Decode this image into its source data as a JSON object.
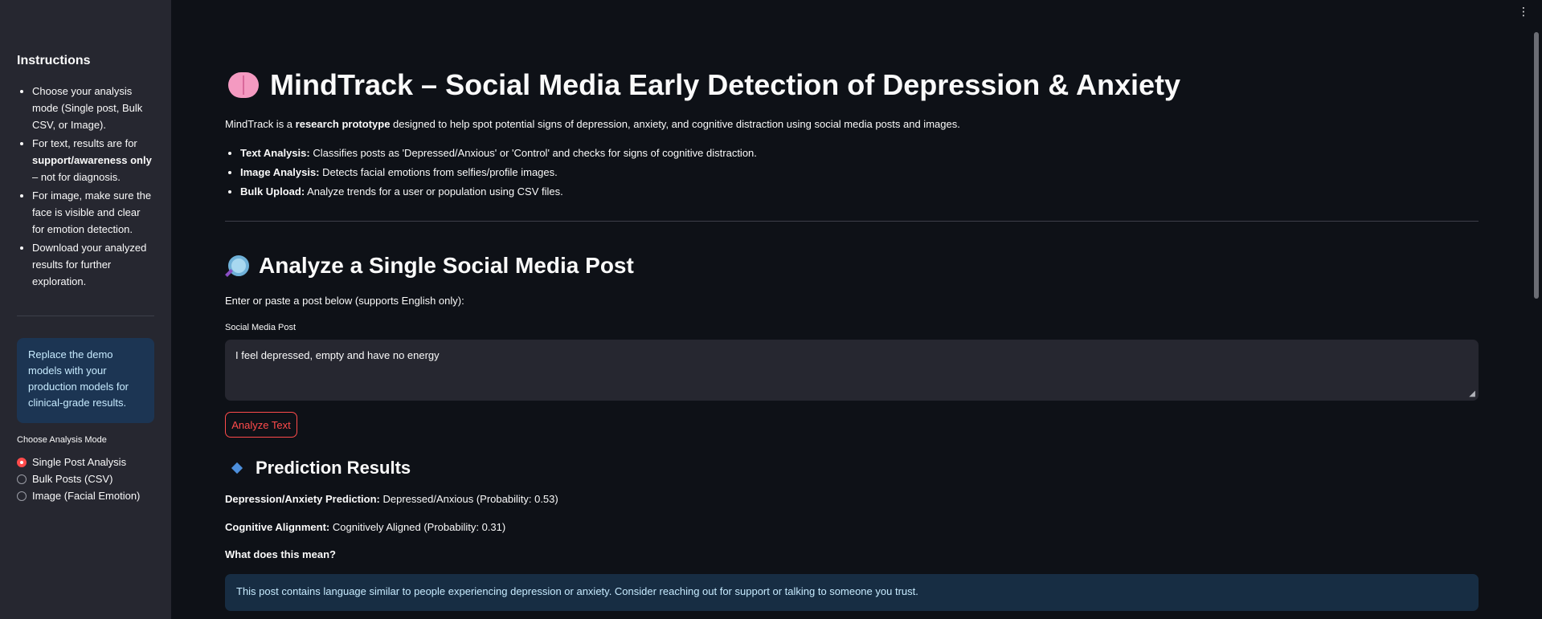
{
  "sidebar": {
    "title": "Instructions",
    "items": [
      {
        "pre": "Choose your analysis mode (Single post, Bulk CSV, or Image).",
        "bold": "",
        "post": ""
      },
      {
        "pre": "For text, results are for ",
        "bold": "support/awareness only",
        "post": " – not for diagnosis."
      },
      {
        "pre": "For image, make sure the face is visible and clear for emotion detection.",
        "bold": "",
        "post": ""
      },
      {
        "pre": "Download your analyzed results for further exploration.",
        "bold": "",
        "post": ""
      }
    ],
    "info": "Replace the demo models with your production models for clinical-grade results.",
    "radio_label": "Choose Analysis Mode",
    "radio_options": [
      "Single Post Analysis",
      "Bulk Posts (CSV)",
      "Image (Facial Emotion)"
    ],
    "radio_selected": 0
  },
  "header": {
    "title": "MindTrack – Social Media Early Detection of Depression & Anxiety",
    "title_icon": "brain-icon",
    "intro_pre": "MindTrack is a ",
    "intro_bold": "research prototype",
    "intro_post": " designed to help spot potential signs of depression, anxiety, and cognitive distraction using social media posts and images.",
    "features": [
      {
        "bold": "Text Analysis:",
        "text": " Classifies posts as 'Depressed/Anxious' or 'Control' and checks for signs of cognitive distraction."
      },
      {
        "bold": "Image Analysis:",
        "text": " Detects facial emotions from selfies/profile images."
      },
      {
        "bold": "Bulk Upload:",
        "text": " Analyze trends for a user or population using CSV files."
      }
    ]
  },
  "single": {
    "title": "Analyze a Single Social Media Post",
    "title_icon": "magnifier-icon",
    "subtext": "Enter or paste a post below (supports English only):",
    "field_label": "Social Media Post",
    "post_value": "I feel depressed, empty and have no energy",
    "button_label": "Analyze Text"
  },
  "results": {
    "title": "Prediction Results",
    "title_icon": "diamond-icon",
    "depression_label": "Depression/Anxiety Prediction:",
    "depression_value": " Depressed/Anxious (Probability: 0.53)",
    "cognitive_label": "Cognitive Alignment:",
    "cognitive_value": " Cognitively Aligned (Probability: 0.31)",
    "meaning_label": "What does this mean?",
    "meaning_text": "This post contains language similar to people experiencing depression or anxiety. Consider reaching out for support or talking to someone you trust."
  },
  "colors": {
    "accent": "#ff4b4b",
    "background": "#0e1117",
    "sidebar": "#262730",
    "info_bg": "#172d43"
  }
}
